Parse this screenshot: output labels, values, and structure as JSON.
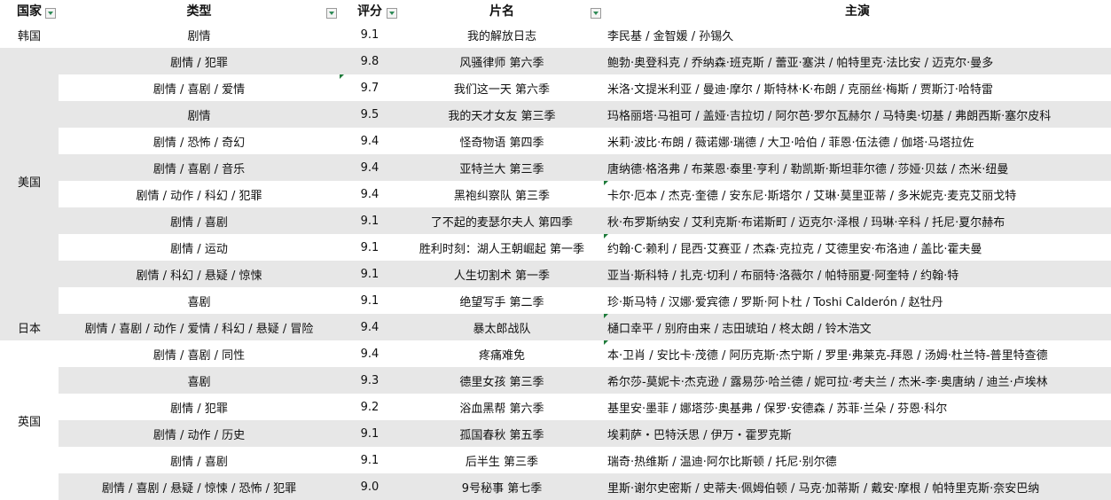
{
  "headers": [
    "国家",
    "类型",
    "评分",
    "片名",
    "主演"
  ],
  "rows": [
    {
      "country": "韩国",
      "genre": "剧情",
      "score": "9.1",
      "title": "我的解放日志",
      "cast": "李民基 / 金智媛 / 孙锡久"
    },
    {
      "country": "美国",
      "genre": "剧情 / 犯罪",
      "score": "9.8",
      "title": "风骚律师 第六季",
      "cast": "鲍勃·奥登科克 / 乔纳森·班克斯 / 蕾亚·塞洪 / 帕特里克·法比安 / 迈克尔·曼多"
    },
    {
      "country": "美国",
      "genre": "剧情 / 喜剧 / 爱情",
      "score": "9.7",
      "title": "我们这一天 第六季",
      "cast": "米洛·文提米利亚 / 曼迪·摩尔 / 斯特林·K·布朗 / 克丽丝·梅斯 / 贾斯汀·哈特雷"
    },
    {
      "country": "美国",
      "genre": "剧情",
      "score": "9.5",
      "title": "我的天才女友 第三季",
      "cast": "玛格丽塔·马祖可 / 盖娅·吉拉切 / 阿尔芭·罗尔瓦赫尔 / 马特奥·切基 / 弗朗西斯·塞尔皮科"
    },
    {
      "country": "美国",
      "genre": "剧情 / 恐怖 / 奇幻",
      "score": "9.4",
      "title": "怪奇物语 第四季",
      "cast": "米莉·波比·布朗 / 薇诺娜·瑞德 / 大卫·哈伯 / 菲恩·伍法德 / 伽塔·马塔拉佐"
    },
    {
      "country": "美国",
      "genre": "剧情 / 喜剧 / 音乐",
      "score": "9.4",
      "title": "亚特兰大 第三季",
      "cast": "唐纳德·格洛弗 / 布莱恩·泰里·亨利 / 勒凯斯·斯坦菲尔德 / 莎娅·贝兹 / 杰米·纽曼"
    },
    {
      "country": "美国",
      "genre": "剧情 / 动作 / 科幻 / 犯罪",
      "score": "9.4",
      "title": "黑袍纠察队 第三季",
      "cast": " 卡尔·厄本 / 杰克·奎德 / 安东尼·斯塔尔 / 艾琳·莫里亚蒂 / 多米妮克·麦克艾丽戈特"
    },
    {
      "country": "美国",
      "genre": "剧情 / 喜剧",
      "score": "9.1",
      "title": "了不起的麦瑟尔夫人 第四季",
      "cast": "秋·布罗斯纳安 / 艾利克斯·布诺斯町 / 迈克尔·泽根 / 玛琳·辛科 / 托尼·夏尔赫布"
    },
    {
      "country": "美国",
      "genre": "剧情 / 运动",
      "score": "9.1",
      "title": "胜利时刻：湖人王朝崛起 第一季",
      "cast": "约翰·C·赖利 / 昆西·艾赛亚 / 杰森·克拉克 / 艾德里安·布洛迪 / 盖比·霍夫曼"
    },
    {
      "country": "美国",
      "genre": "剧情 / 科幻 / 悬疑 / 惊悚",
      "score": "9.1",
      "title": "人生切割术 第一季",
      "cast": "亚当·斯科特 / 扎克·切利 / 布丽特·洛薇尔 / 帕特丽夏·阿奎特 / 约翰·特"
    },
    {
      "country": "美国",
      "genre": "喜剧",
      "score": "9.1",
      "title": "绝望写手 第二季",
      "cast": "珍·斯马特 / 汉娜·爱宾德 / 罗斯·阿卜杜 / Toshi Calderón / 赵牡丹"
    },
    {
      "country": "日本",
      "genre": "剧情 / 喜剧 / 动作 / 爱情 / 科幻 / 悬疑 / 冒险",
      "score": "9.4",
      "title": "暴太郎战队",
      "cast": "樋口幸平 / 别府由来 / 志田琥珀 / 柊太朗 / 铃木浩文"
    },
    {
      "country": "英国",
      "genre": "剧情 / 喜剧 / 同性",
      "score": "9.4",
      "title": "疼痛难免",
      "cast": " 本·卫肖 / 安比卡·茂德 / 阿历克斯·杰宁斯 / 罗里·弗莱克-拜恩 / 汤姆·杜兰特-普里特查德"
    },
    {
      "country": "英国",
      "genre": "喜剧",
      "score": "9.3",
      "title": "德里女孩 第三季",
      "cast": "希尔莎-莫妮卡·杰克逊 / 露易莎·哈兰德 / 妮可拉·考夫兰 / 杰米-李·奥唐纳 / 迪兰·卢埃林"
    },
    {
      "country": "英国",
      "genre": "剧情 / 犯罪",
      "score": "9.2",
      "title": "浴血黑帮 第六季",
      "cast": "基里安·墨菲 / 娜塔莎·奥基弗 / 保罗·安德森 / 苏菲·兰朵 / 芬恩·科尔"
    },
    {
      "country": "英国",
      "genre": "剧情 / 动作 / 历史",
      "score": "9.1",
      "title": "孤国春秋 第五季",
      "cast": "埃莉萨・巴特沃思   /   伊万・霍罗克斯"
    },
    {
      "country": "英国",
      "genre": "剧情 / 喜剧",
      "score": "9.1",
      "title": "后半生 第三季",
      "cast": "瑞奇·热维斯 / 温迪·阿尔比斯顿 / 托尼·别尔德"
    },
    {
      "country": "英国",
      "genre": "剧情 / 喜剧 / 悬疑 / 惊悚 / 恐怖 / 犯罪",
      "score": "9.0",
      "title": "9号秘事 第七季",
      "cast": "里斯·谢尔史密斯 / 史蒂夫·佩姆伯顿 / 马克·加蒂斯 / 戴安·摩根 / 帕特里克斯·奈安巴纳"
    }
  ]
}
